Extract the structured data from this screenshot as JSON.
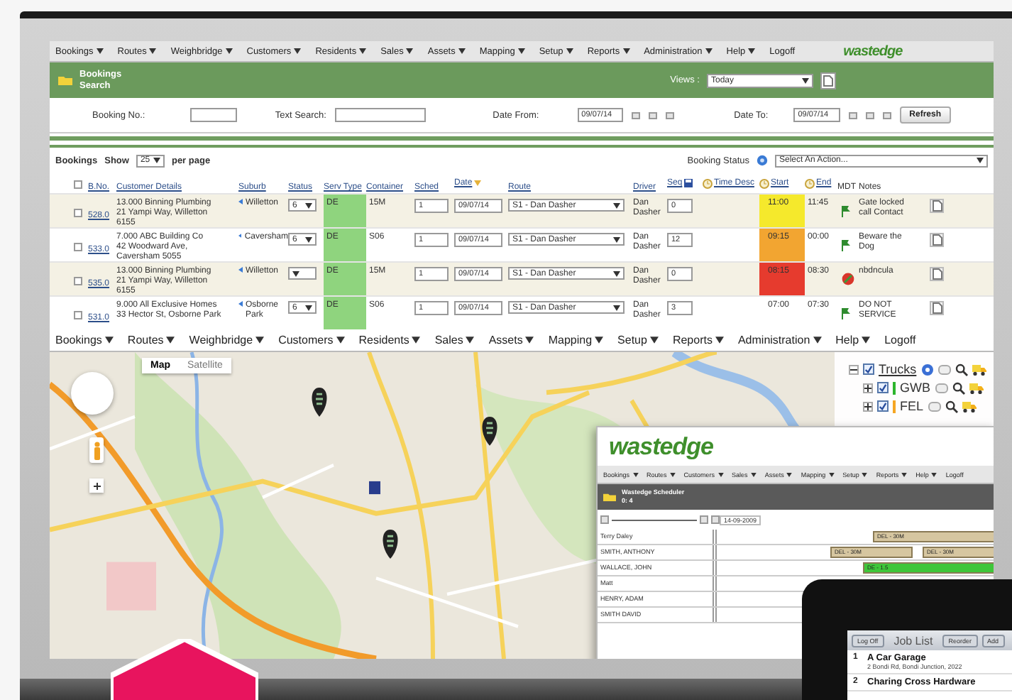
{
  "top_menu": {
    "items": [
      {
        "label": "Bookings",
        "dropdown": true
      },
      {
        "label": "Routes",
        "dropdown": true
      },
      {
        "label": "Weighbridge",
        "dropdown": true
      },
      {
        "label": "Customers",
        "dropdown": true
      },
      {
        "label": "Residents",
        "dropdown": true
      },
      {
        "label": "Sales",
        "dropdown": true
      },
      {
        "label": "Assets",
        "dropdown": true
      },
      {
        "label": "Mapping",
        "dropdown": true
      },
      {
        "label": "Setup",
        "dropdown": true
      },
      {
        "label": "Reports",
        "dropdown": true
      },
      {
        "label": "Administration",
        "dropdown": true
      },
      {
        "label": "Help",
        "dropdown": true
      },
      {
        "label": "Logoff",
        "dropdown": false
      }
    ],
    "logo": "wastedge"
  },
  "header": {
    "title": "Bookings",
    "subtitle": "Search",
    "views_label": "Views :",
    "views_value": "Today"
  },
  "search": {
    "booking_no_label": "Booking No.:",
    "text_search_label": "Text Search:",
    "date_from_label": "Date From:",
    "date_from": "09/07/14",
    "date_to_label": "Date To:",
    "date_to": "09/07/14",
    "refresh": "Refresh"
  },
  "toolbar": {
    "title": "Bookings",
    "show": "Show",
    "page_size": "25",
    "per_page": "per page",
    "status_label": "Booking Status",
    "action_placeholder": "Select An Action..."
  },
  "table": {
    "all_checked": false,
    "columns": [
      {
        "label": "B.No.",
        "kind": "link"
      },
      {
        "label": "Customer Details",
        "kind": "link"
      },
      {
        "label": "Suburb",
        "kind": "link"
      },
      {
        "label": "Status",
        "kind": "link"
      },
      {
        "label": "Serv Type",
        "kind": "link"
      },
      {
        "label": "Container",
        "kind": "link"
      },
      {
        "label": "Sched",
        "kind": "link"
      },
      {
        "label": "Date",
        "kind": "sorted"
      },
      {
        "label": "Route",
        "kind": "link"
      },
      {
        "label": "Driver",
        "kind": "link"
      },
      {
        "label": "Seq",
        "kind": "save"
      },
      {
        "label": "Time Desc",
        "kind": "clock"
      },
      {
        "label": "Start",
        "kind": "clock"
      },
      {
        "label": "End",
        "kind": "clock"
      },
      {
        "label": "MDT",
        "kind": "plain"
      },
      {
        "label": "Notes",
        "kind": "plain"
      }
    ],
    "rows": [
      {
        "checked": false,
        "bno": "528.0",
        "customer": "13.000 Binning Plumbing\n21 Yampi Way, Willetton\n6155",
        "suburb": "Willetton",
        "status": "6",
        "serv_type": "DE",
        "container": "15M",
        "sched": "1",
        "date": "09/07/14",
        "route": "S1 - Dan Dasher",
        "driver": "Dan\nDasher",
        "seq": "0",
        "start": {
          "time": "11:00",
          "color": "#f5e92c"
        },
        "end": "11:45",
        "mdt_blocked": false,
        "notes": "Gate locked\ncall Contact"
      },
      {
        "checked": false,
        "bno": "533.0",
        "customer": "7.000 ABC Building Co\n42 Woodward Ave,\nCaversham 5055",
        "suburb": "Caversham",
        "status": "6",
        "serv_type": "DE",
        "container": "S06",
        "sched": "1",
        "date": "09/07/14",
        "route": "S1 - Dan Dasher",
        "driver": "Dan\nDasher",
        "seq": "12",
        "start": {
          "time": "09:15",
          "color": "#f2a531"
        },
        "end": "00:00",
        "mdt_blocked": false,
        "notes": "Beware the\nDog"
      },
      {
        "checked": false,
        "bno": "535.0",
        "customer": "13.000 Binning Plumbing\n21 Yampi Way, Willetton\n6155",
        "suburb": "Willetton",
        "serv_type": "DE",
        "container": "15M",
        "sched": "1",
        "date": "09/07/14",
        "route": "S1 - Dan Dasher",
        "driver": "Dan\nDasher",
        "seq": "0",
        "start": {
          "time": "08:15",
          "color": "#e63b2e"
        },
        "end": "08:30",
        "mdt_blocked": true,
        "notes": "nbdncula"
      },
      {
        "checked": false,
        "bno": "531.0",
        "customer": "9.000 All Exclusive Homes\n33 Hector St, Osborne Park",
        "suburb": "Osborne\nPark",
        "status": "6",
        "serv_type": "DE",
        "container": "S06",
        "sched": "1",
        "date": "09/07/14",
        "route": "S1 - Dan Dasher",
        "driver": "Dan\nDasher",
        "seq": "3",
        "start": {
          "time": "07:00"
        },
        "end": "07:30",
        "mdt_blocked": false,
        "notes": "DO NOT\nSERVICE"
      }
    ]
  },
  "map_menu": {
    "items": [
      {
        "label": "Bookings",
        "dropdown": true
      },
      {
        "label": "Routes",
        "dropdown": true
      },
      {
        "label": "Weighbridge",
        "dropdown": true
      },
      {
        "label": "Customers",
        "dropdown": true
      },
      {
        "label": "Residents",
        "dropdown": true
      },
      {
        "label": "Sales",
        "dropdown": true
      },
      {
        "label": "Assets",
        "dropdown": true
      },
      {
        "label": "Mapping",
        "dropdown": true
      },
      {
        "label": "Setup",
        "dropdown": true
      },
      {
        "label": "Reports",
        "dropdown": true
      },
      {
        "label": "Administration",
        "dropdown": true
      },
      {
        "label": "Help",
        "dropdown": true
      },
      {
        "label": "Logoff",
        "dropdown": false
      }
    ]
  },
  "map": {
    "tabs": [
      {
        "label": "Map",
        "selected": true
      },
      {
        "label": "Satellite",
        "selected": false
      }
    ],
    "layers": [
      {
        "label": "Trucks",
        "checked": true,
        "expanded": true,
        "children": [
          {
            "label": "GWB",
            "checked": true,
            "expanded": false,
            "color": "#2db52d"
          },
          {
            "label": "FEL",
            "checked": true,
            "expanded": false,
            "color": "#f5a623"
          }
        ]
      }
    ]
  },
  "scheduler": {
    "logo": "wastedge",
    "menu": [
      {
        "label": "Bookings",
        "dropdown": true
      },
      {
        "label": "Routes",
        "dropdown": true
      },
      {
        "label": "Customers",
        "dropdown": true
      },
      {
        "label": "Sales",
        "dropdown": true
      },
      {
        "label": "Assets",
        "dropdown": true
      },
      {
        "label": "Mapping",
        "dropdown": true
      },
      {
        "label": "Setup",
        "dropdown": true
      },
      {
        "label": "Reports",
        "dropdown": true
      },
      {
        "label": "Help",
        "dropdown": true
      },
      {
        "label": "Logoff",
        "dropdown": false
      }
    ],
    "title": "Wastedge Scheduler",
    "subtitle": "0: 4",
    "date": "14-09-2009",
    "resources": [
      {
        "name": "Terry Daley",
        "bars": [
          {
            "label": "DEL - 30M",
            "color": "#d6c6a0"
          }
        ]
      },
      {
        "name": "SMITH, ANTHONY",
        "bars": [
          {
            "label": "DEL - 30M",
            "color": "#d6c6a0"
          },
          {
            "label": "DEL - 30M",
            "color": "#d6c6a0"
          }
        ]
      },
      {
        "name": "WALLACE, JOHN",
        "bars": [
          {
            "label": "DE - 1.5",
            "color": "#3fc63a"
          }
        ]
      },
      {
        "name": "Matt"
      },
      {
        "name": "HENRY, ADAM"
      },
      {
        "name": "SMITH DAVID"
      }
    ]
  },
  "tablet": {
    "log_off": "Log Off",
    "title": "Job List",
    "buttons": [
      "Reorder",
      "Add"
    ],
    "jobs": [
      {
        "number": "1",
        "name": "A Car Garage",
        "address": "2 Bondi Rd, Bondi Junction, 2022"
      },
      {
        "number": "2",
        "name": "Charing Cross Hardware"
      }
    ]
  }
}
